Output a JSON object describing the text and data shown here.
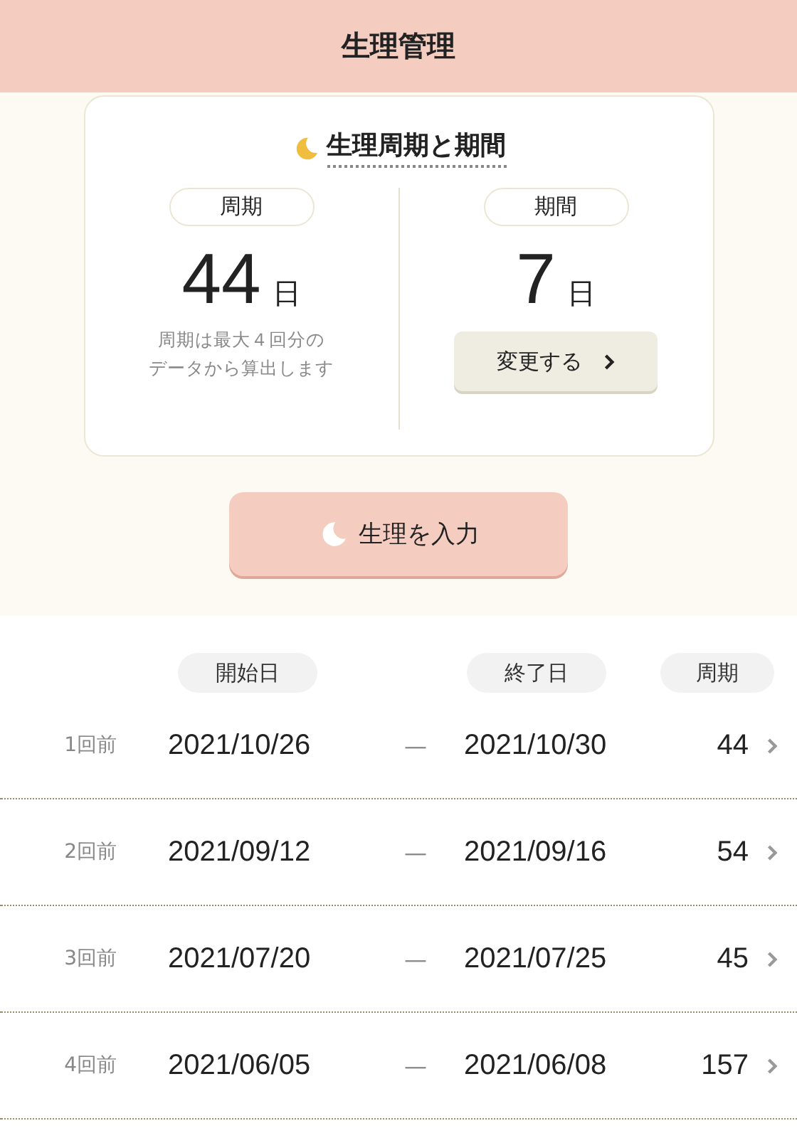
{
  "header": {
    "title": "生理管理"
  },
  "summary": {
    "title": "生理周期と期間",
    "cycle": {
      "label": "周期",
      "value": "44",
      "unit": "日",
      "note": [
        "周期は最大４回分の",
        "データから算出します"
      ]
    },
    "period": {
      "label": "期間",
      "value": "7",
      "unit": "日",
      "button": "変更する"
    }
  },
  "input_button": "生理を入力",
  "table": {
    "columns": [
      "開始日",
      "終了日",
      "周期"
    ],
    "rows": [
      {
        "index": "1回前",
        "start": "2021/10/26",
        "separator": "—",
        "end": "2021/10/30",
        "cycle": "44"
      },
      {
        "index": "2回前",
        "start": "2021/09/12",
        "separator": "—",
        "end": "2021/09/16",
        "cycle": "54"
      },
      {
        "index": "3回前",
        "start": "2021/07/20",
        "separator": "—",
        "end": "2021/07/25",
        "cycle": "45"
      },
      {
        "index": "4回前",
        "start": "2021/06/05",
        "separator": "—",
        "end": "2021/06/08",
        "cycle": "157"
      }
    ]
  }
}
